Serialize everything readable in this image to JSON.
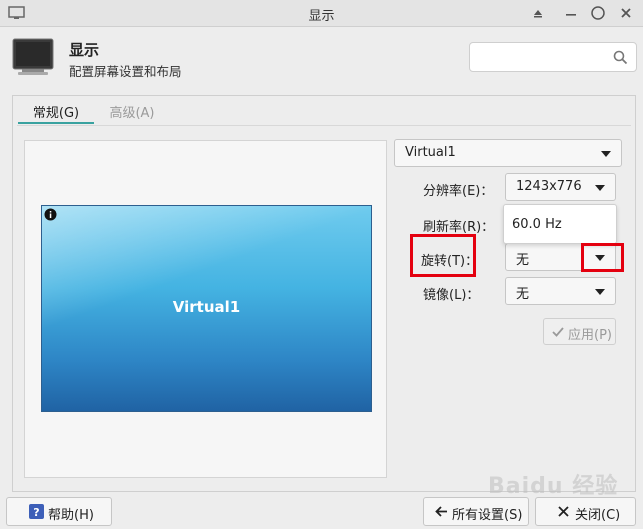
{
  "window": {
    "title": "显示"
  },
  "header": {
    "title": "显示",
    "subtitle": "配置屏幕设置和布局"
  },
  "search": {
    "placeholder": "",
    "icon": "search-icon"
  },
  "tabs": [
    {
      "label": "常规(G)",
      "active": true
    },
    {
      "label": "高级(A)",
      "active": false
    }
  ],
  "preview": {
    "monitor_name": "Virtual1"
  },
  "settings": {
    "display_select": "Virtual1",
    "resolution_label": "分辨率(E)：",
    "resolution_value": "1243x776",
    "refresh_label": "刷新率(R)：",
    "refresh_option": "60.0 Hz",
    "rotation_label": "旋转(T)：",
    "rotation_value": "无",
    "mirror_label": "镜像(L)：",
    "mirror_value": "无",
    "apply_label": "应用(P)"
  },
  "footer": {
    "help_label": "帮助(H)",
    "all_settings_label": "所有设置(S)",
    "close_label": "关闭(C)"
  },
  "watermark": "Baidu 经验",
  "colors": {
    "highlight": "#e4000f",
    "tab_accent": "#3aa2a0",
    "help_icon": "#3d5fb8"
  }
}
